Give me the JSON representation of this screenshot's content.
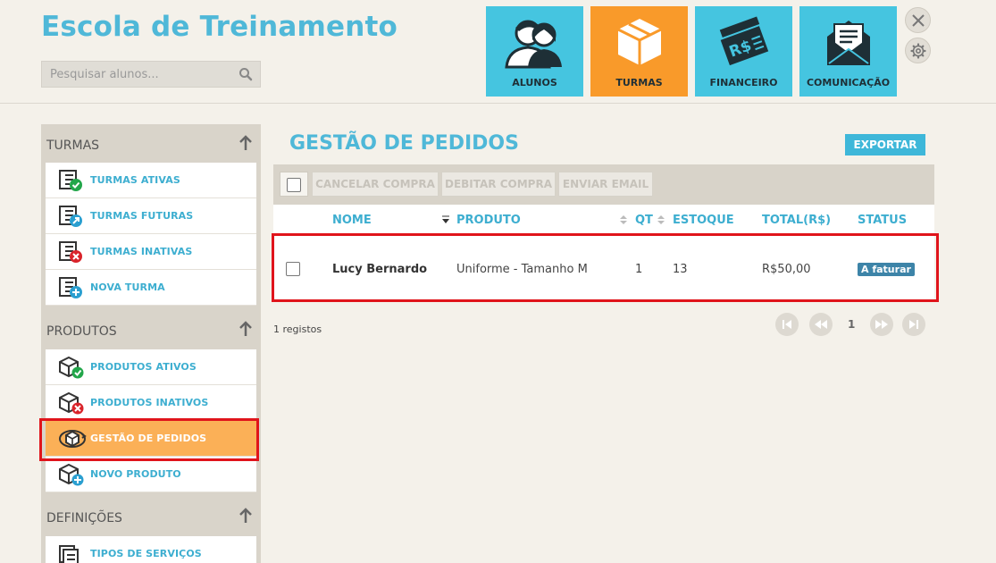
{
  "app": {
    "title": "Escola de Treinamento"
  },
  "search": {
    "placeholder": "Pesquisar alunos..."
  },
  "nav": [
    {
      "label": "ALUNOS",
      "icon": "students-icon",
      "active": false
    },
    {
      "label": "TURMAS",
      "icon": "box-icon",
      "active": true
    },
    {
      "label": "FINANCEIRO",
      "icon": "money-icon",
      "active": false
    },
    {
      "label": "COMUNICAÇÃO",
      "icon": "mail-icon",
      "active": false
    }
  ],
  "sidebar": {
    "turmas": {
      "title": "TURMAS",
      "items": [
        {
          "label": "TURMAS ATIVAS",
          "icon": "checklist-check-icon"
        },
        {
          "label": "TURMAS FUTURAS",
          "icon": "checklist-forward-icon"
        },
        {
          "label": "TURMAS INATIVAS",
          "icon": "checklist-x-icon"
        },
        {
          "label": "NOVA TURMA",
          "icon": "checklist-plus-icon"
        }
      ]
    },
    "produtos": {
      "title": "PRODUTOS",
      "items": [
        {
          "label": "PRODUTOS ATIVOS",
          "icon": "box-check-icon"
        },
        {
          "label": "PRODUTOS INATIVOS",
          "icon": "box-x-icon"
        },
        {
          "label": "GESTÃO DE PEDIDOS",
          "icon": "box-cycle-icon",
          "active": true
        },
        {
          "label": "NOVO PRODUTO",
          "icon": "box-plus-icon"
        }
      ]
    },
    "definicoes": {
      "title": "DEFINIÇÕES",
      "items": [
        {
          "label": "TIPOS DE SERVIÇOS",
          "icon": "services-icon"
        }
      ]
    }
  },
  "main": {
    "title": "GESTÃO DE PEDIDOS",
    "export_label": "EXPORTAR",
    "toolbar": {
      "cancel": "CANCELAR COMPRA",
      "debit": "DEBITAR COMPRA",
      "email": "ENVIAR EMAIL"
    },
    "columns": {
      "nome": "NOME",
      "produto": "PRODUTO",
      "qt": "QT",
      "estoque": "ESTOQUE",
      "total": "TOTAL(R$)",
      "status": "STATUS"
    },
    "rows": [
      {
        "nome": "Lucy Bernardo",
        "produto": "Uniforme - Tamanho M",
        "qt": "1",
        "estoque": "13",
        "total": "R$50,00",
        "status": "A faturar"
      }
    ],
    "records": "1 registos",
    "page": "1"
  },
  "colors": {
    "accent": "#4fb8d8",
    "tile": "#45c5e0",
    "tile_active": "#f99a2a",
    "status": "#3d84a8",
    "highlight": "#e0141b"
  }
}
